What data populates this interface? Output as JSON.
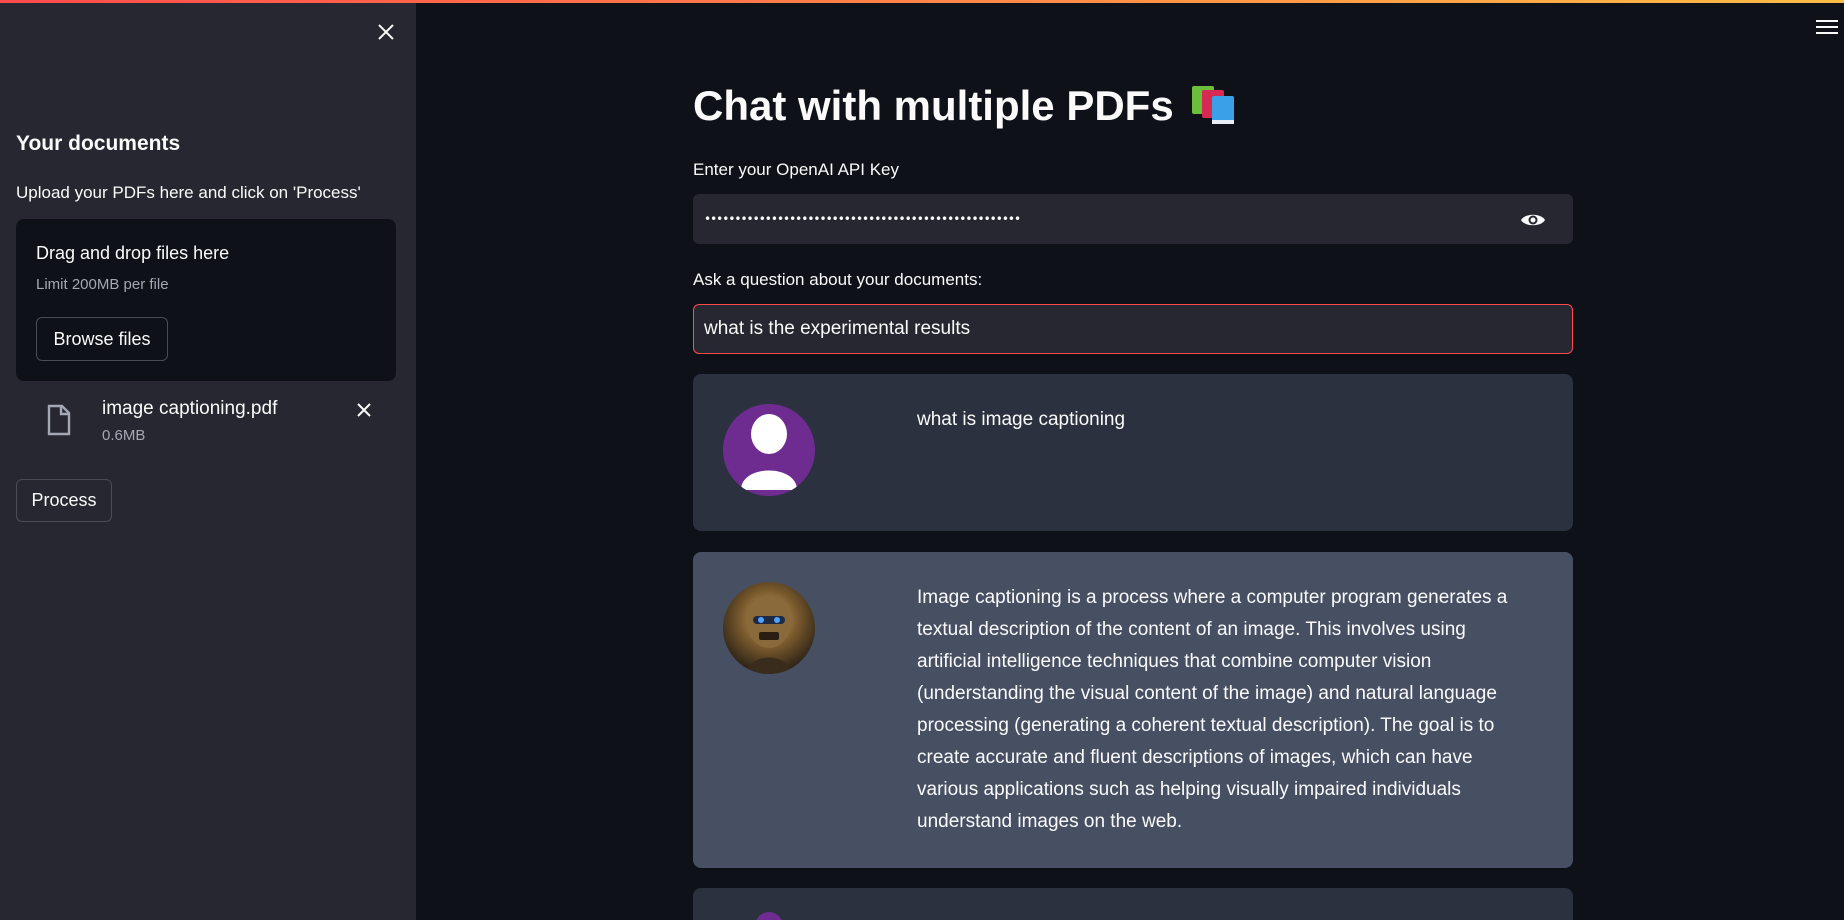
{
  "sidebar": {
    "heading": "Your documents",
    "description": "Upload your PDFs here and click on 'Process'",
    "dropzone": {
      "title": "Drag and drop files here",
      "limit": "Limit 200MB per file",
      "browse_label": "Browse files"
    },
    "file": {
      "name": "image captioning.pdf",
      "size": "0.6MB"
    },
    "process_label": "Process"
  },
  "main": {
    "title": "Chat with multiple PDFs",
    "title_icon": "books-icon",
    "api_key": {
      "label": "Enter your OpenAI API Key",
      "masked_value": "••••••••••••••••••••••••••••••••••••••••••••••••••••"
    },
    "question": {
      "label": "Ask a question about your documents:",
      "value": "what is the experimental results"
    },
    "messages": [
      {
        "role": "user",
        "text": "what is image captioning"
      },
      {
        "role": "bot",
        "text": "Image captioning is a process where a computer program generates a textual description of the content of an image. This involves using artificial intelligence techniques that combine computer vision (understanding the visual content of the image) and natural language processing (generating a coherent textual description). The goal is to create accurate and fluent descriptions of images, which can have various applications such as helping visually impaired individuals understand images on the web."
      }
    ]
  },
  "colors": {
    "background": "#0e1117",
    "sidebar": "#262730",
    "accent": "#ff4b4b",
    "user_message_bg": "#2b313e",
    "bot_message_bg": "#475063"
  }
}
